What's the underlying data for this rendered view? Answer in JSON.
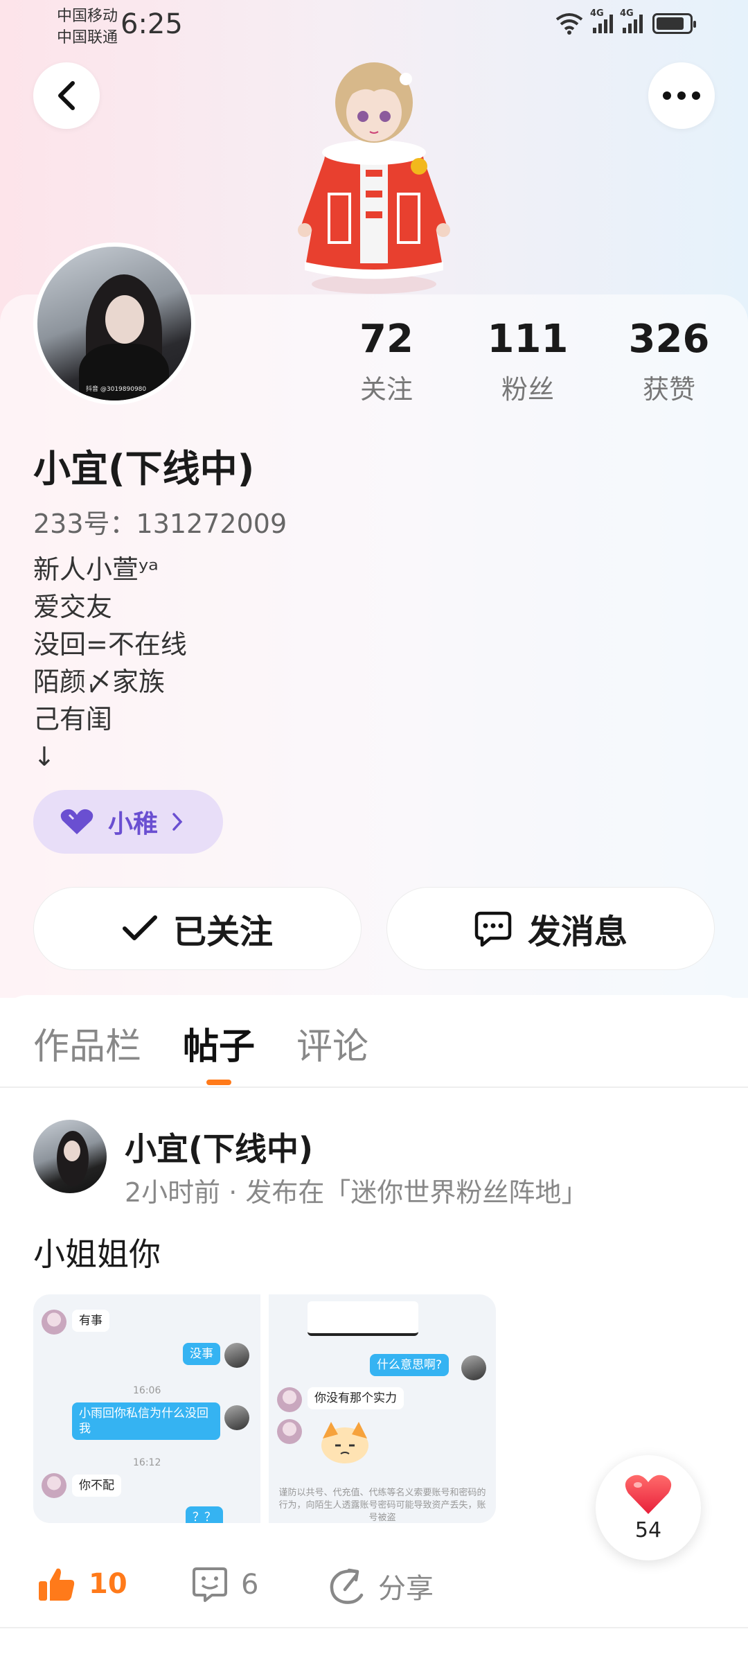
{
  "status_bar": {
    "carrier_1": "中国移动",
    "carrier_2": "中国联通",
    "time": "6:25",
    "net_1": "4G",
    "net_2": "4G"
  },
  "header": {
    "back_icon": "chevron-left-icon",
    "more_icon": "more-horizontal-icon"
  },
  "profile": {
    "stats": [
      {
        "value": "72",
        "label": "关注"
      },
      {
        "value": "111",
        "label": "粉丝"
      },
      {
        "value": "326",
        "label": "获赞"
      }
    ],
    "nickname": "小宜(下线中)",
    "uid": "233号：131272009",
    "bio": "新人小萱ʸᵃ\n爱交友\n没回=不在线\n陌颜〆家族\n己有闺\n↓",
    "avatar_watermark": "抖音 @3019890980",
    "tag": "小稚"
  },
  "actions": {
    "follow": "已关注",
    "message": "发消息"
  },
  "tabs": [
    "作品栏",
    "帖子",
    "评论"
  ],
  "post": {
    "author": "小宜(下线中)",
    "meta": "2小时前 · 发布在「迷你世界粉丝阵地」",
    "text": "小姐姐你",
    "chat_left": {
      "msg1": "有事",
      "msg2": "没事",
      "time1": "16:06",
      "msg3": "小雨回你私信为什么没回我",
      "time2": "16:12",
      "msg4": "你不配",
      "msg5": "？？"
    },
    "chat_right": {
      "msg1": "什么意思啊?",
      "msg2": "你没有那个实力",
      "notice": "谨防以共号、代充值、代练等名义索要账号和密码的行为，向陌生人透露账号密码可能导致资产丢失，账号被盗"
    },
    "likes": "10",
    "comments": "6",
    "share": "分享",
    "fab_count": "54"
  },
  "colors": {
    "accent": "#ff7a1a",
    "tag_purple": "#6a4fd1",
    "chat_blue": "#35b3f2"
  }
}
